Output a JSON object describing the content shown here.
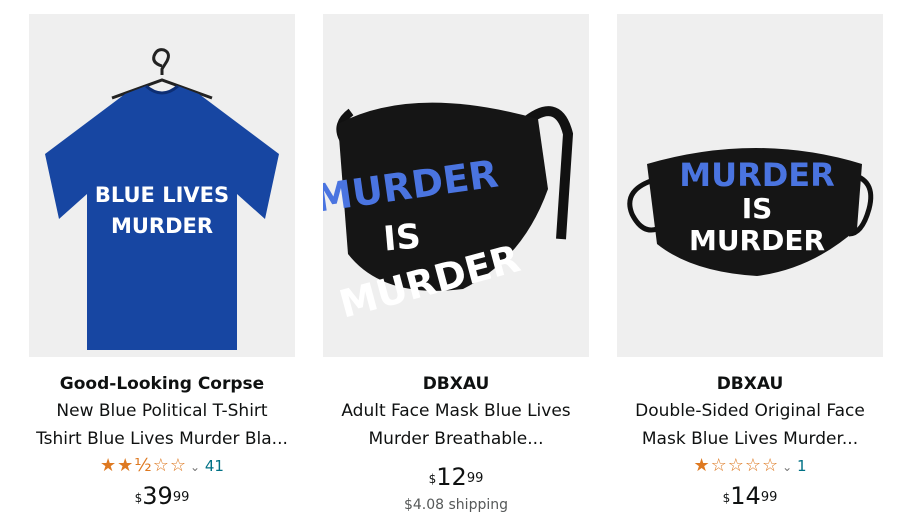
{
  "products": [
    {
      "brand": "Good-Looking Corpse",
      "title_line1": "New Blue Political T-Shirt",
      "title_line2": "Tshirt Blue Lives Murder Bla...",
      "stars_display": "★★½☆☆",
      "rating_count": "41",
      "price_dollars": "39",
      "price_cents": "99",
      "image_text": [
        "BLUE LIVES",
        "MURDER"
      ],
      "image_color": "#1746a2"
    },
    {
      "brand": "DBXAU",
      "title_line1": "Adult Face Mask Blue Lives",
      "title_line2": "Murder Breathable...",
      "price_dollars": "12",
      "price_cents": "99",
      "shipping": "$4.08 shipping",
      "image_text": [
        "MURDER",
        "IS",
        "MURDER"
      ],
      "image_accent": "#4a74e0"
    },
    {
      "brand": "DBXAU",
      "title_line1": "Double-Sided Original Face",
      "title_line2": "Mask Blue Lives Murder...",
      "stars_display": "★☆☆☆☆",
      "rating_count": "1",
      "price_dollars": "14",
      "price_cents": "99",
      "image_text": [
        "MURDER",
        "IS",
        "MURDER"
      ],
      "image_accent": "#4a74e0"
    }
  ],
  "currency_symbol": "$",
  "rating_chevron": "⌄"
}
